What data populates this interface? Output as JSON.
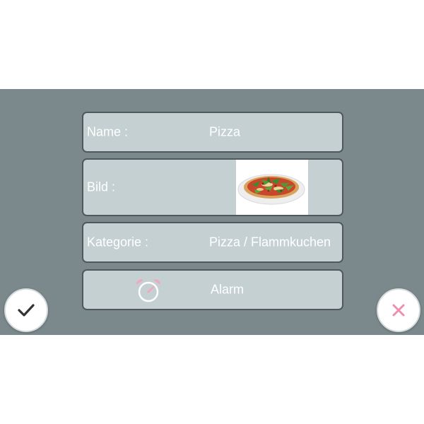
{
  "form": {
    "name_label": "Name :",
    "name_value": "Pizza",
    "image_label": "Bild :",
    "category_label": "Kategorie :",
    "category_value": "Pizza / Flammkuchen",
    "alarm_label": "Alarm"
  },
  "buttons": {
    "confirm_icon": "checkmark-icon",
    "cancel_icon": "close-icon"
  },
  "colors": {
    "screen_bg": "#7b888c",
    "row_bg": "#c5d0d2",
    "row_border": "#4f585c",
    "alarm_accent": "#f2a7bd",
    "cancel_accent": "#ef8fae",
    "confirm_accent": "#333333"
  }
}
